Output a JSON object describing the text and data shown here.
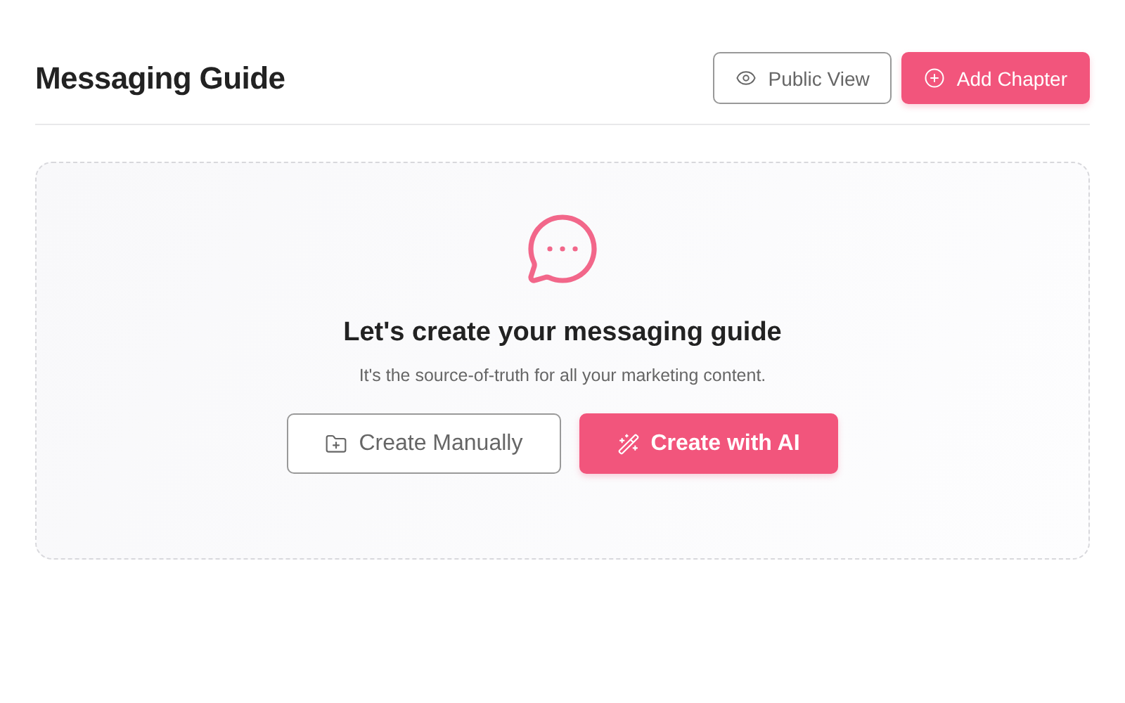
{
  "header": {
    "title": "Messaging Guide",
    "actions": [
      {
        "label": "Public View",
        "kind": "outline"
      },
      {
        "label": "Add Chapter",
        "kind": "primary"
      }
    ]
  },
  "empty_state": {
    "heading": "Let's create your messaging guide",
    "description": "It's the source-of-truth for all your marketing content.",
    "actions": [
      {
        "label": "Create Manually",
        "kind": "outline"
      },
      {
        "label": "Create with AI",
        "kind": "primary"
      }
    ]
  }
}
